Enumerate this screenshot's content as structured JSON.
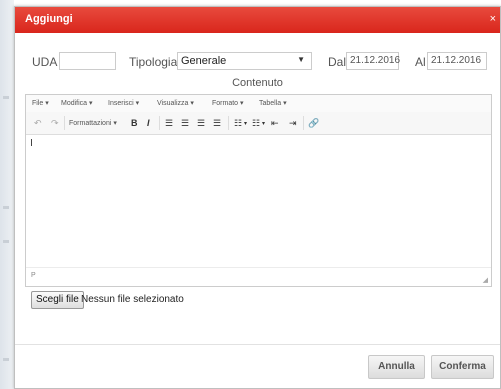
{
  "dialog": {
    "title": "Aggiungi",
    "close_glyph": "×"
  },
  "form": {
    "uda_label": "UDA",
    "uda_value": "",
    "tipologia_label": "Tipologia",
    "tipologia_value": "Generale",
    "dal_label": "Dal",
    "dal_value": "21.12.2016",
    "al_label": "Al",
    "al_value": "21.12.2016"
  },
  "contenuto_label": "Contenuto",
  "editor": {
    "menus": [
      "File",
      "Modifica",
      "Inserisci",
      "Visualizza",
      "Formato",
      "Tabella"
    ],
    "formats_label": "Formattazioni",
    "status_path": "P"
  },
  "file": {
    "button_label": "Scegli file",
    "status_text": "Nessun file selezionato"
  },
  "buttons": {
    "cancel": "Annulla",
    "confirm": "Conferma"
  },
  "colors": {
    "titlebar": "#e2362b",
    "accent_text": "#ffffff"
  }
}
